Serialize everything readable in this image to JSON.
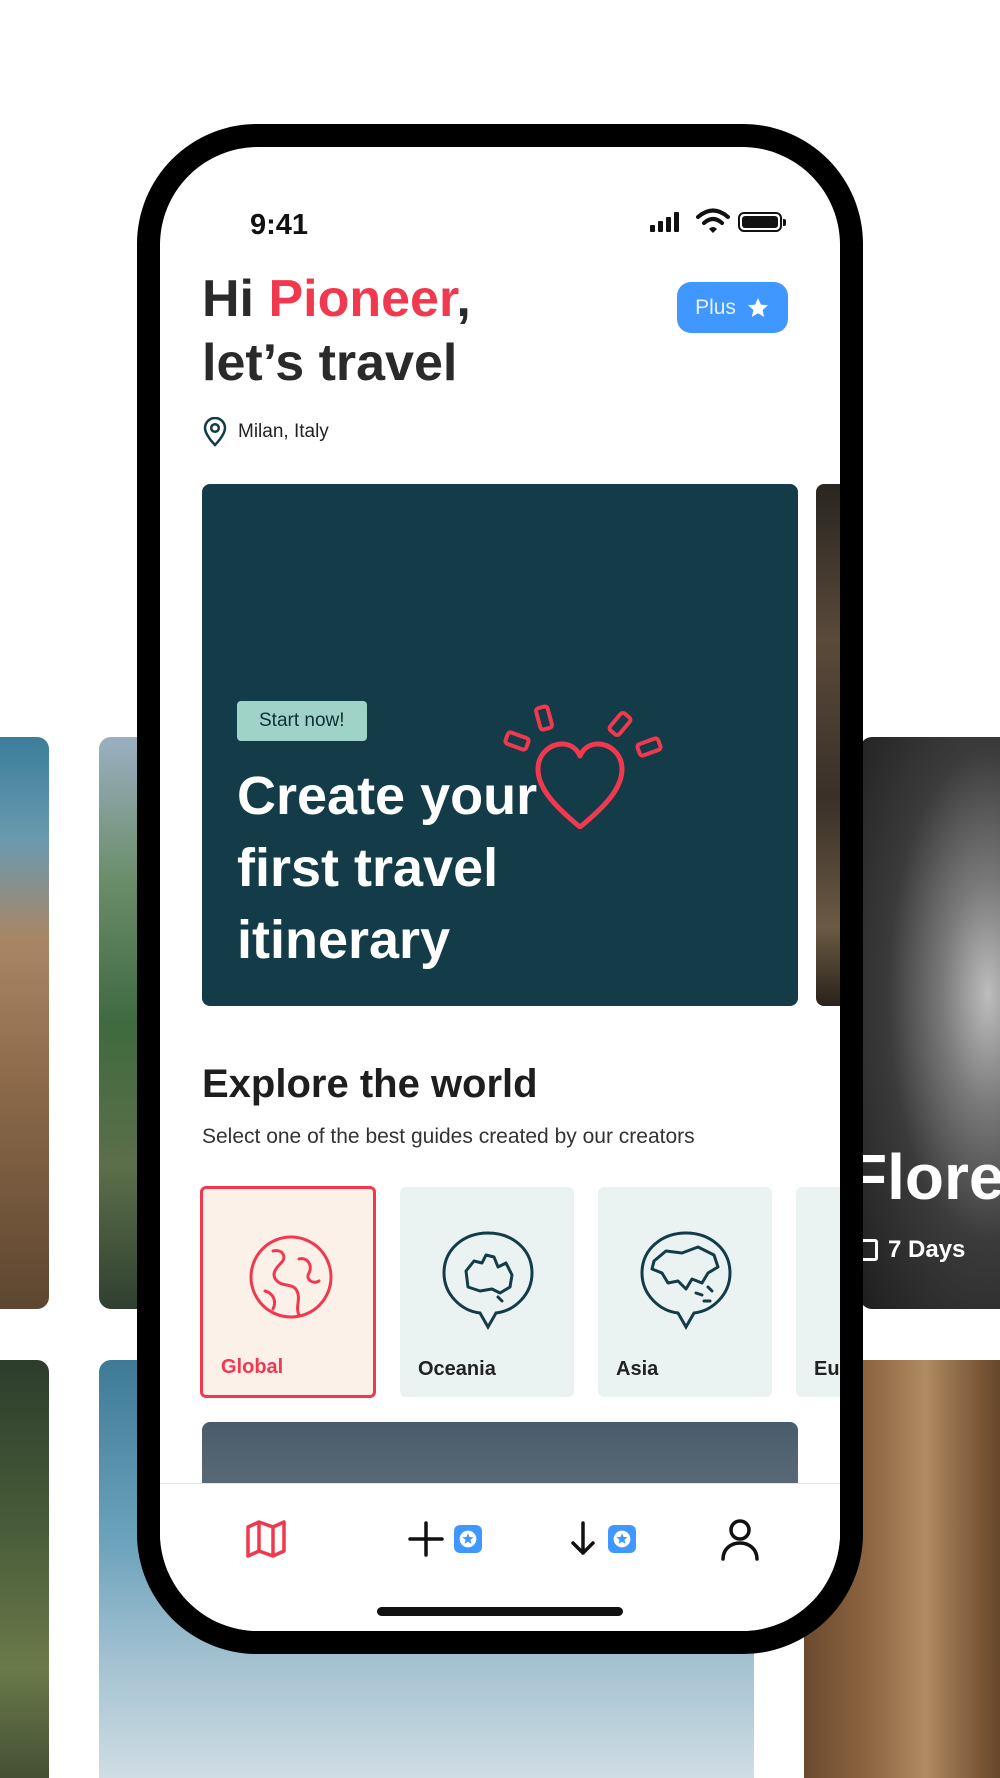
{
  "background": {
    "florence_title": "Floren",
    "florence_days": "7 Days"
  },
  "status_bar": {
    "time": "9:41"
  },
  "header": {
    "greeting_prefix": "Hi ",
    "greeting_name": "Pioneer",
    "greeting_suffix": ",",
    "greeting_line2": "let’s travel",
    "plus_label": "Plus",
    "location": "Milan, Italy"
  },
  "hero": {
    "badge": "Start now!",
    "title": "Create your first travel itinerary"
  },
  "explore": {
    "title": "Explore the world",
    "subtitle": "Select one of the best guides created by our creators",
    "regions": [
      {
        "label": "Global",
        "icon": "globe-icon",
        "active": true
      },
      {
        "label": "Oceania",
        "icon": "oceania-map-icon",
        "active": false
      },
      {
        "label": "Asia",
        "icon": "asia-map-icon",
        "active": false
      },
      {
        "label": "Eu",
        "icon": "europe-map-icon",
        "active": false
      }
    ]
  },
  "tabbar": {
    "items": [
      {
        "icon": "map-icon",
        "active": true
      },
      {
        "icon": "plus-icon",
        "badge": "star-badge-icon"
      },
      {
        "icon": "download-icon",
        "badge": "star-badge-icon"
      },
      {
        "icon": "profile-icon"
      }
    ]
  },
  "colors": {
    "accent": "#f0384f",
    "primary_blue": "#3f97ff",
    "hero_bg": "#133c48",
    "badge_bg": "#9fd3c7"
  }
}
